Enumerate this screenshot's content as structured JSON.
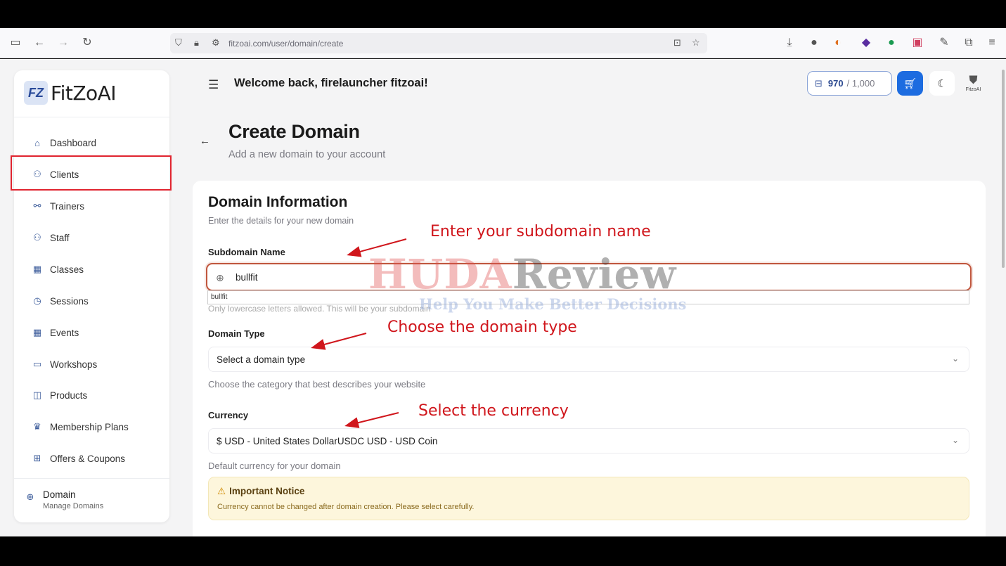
{
  "browser": {
    "url": "fitzoai.com/user/domain/create"
  },
  "brand": {
    "logo_mark": "FZ",
    "name": "FitZoAI"
  },
  "sidebar": {
    "items": [
      {
        "label": "Dashboard",
        "icon": "home-icon"
      },
      {
        "label": "Clients",
        "icon": "users-icon"
      },
      {
        "label": "Trainers",
        "icon": "trainers-icon"
      },
      {
        "label": "Staff",
        "icon": "staff-icon"
      },
      {
        "label": "Classes",
        "icon": "calendar-icon"
      },
      {
        "label": "Sessions",
        "icon": "timer-icon"
      },
      {
        "label": "Events",
        "icon": "calendar-icon"
      },
      {
        "label": "Workshops",
        "icon": "monitor-icon"
      },
      {
        "label": "Products",
        "icon": "bag-icon"
      },
      {
        "label": "Membership Plans",
        "icon": "crown-icon"
      },
      {
        "label": "Offers & Coupons",
        "icon": "gift-icon"
      }
    ],
    "footer": {
      "title": "Domain",
      "subtitle": "Manage Domains"
    }
  },
  "header": {
    "welcome": "Welcome back, firelauncher fitzoai!",
    "credits_value": "970",
    "credits_max": "/ 1,000",
    "avatar_text": "FitzoAI"
  },
  "page": {
    "title": "Create Domain",
    "subtitle": "Add a new domain to your account"
  },
  "form": {
    "section_title": "Domain Information",
    "section_subtitle": "Enter the details for your new domain",
    "subdomain_label": "Subdomain Name",
    "subdomain_value": "bullfit",
    "autocomplete_suggestion": "bullfit",
    "subdomain_hint": "Only lowercase letters allowed. This will be your subdomain",
    "domain_type_label": "Domain Type",
    "domain_type_value": "Select a domain type",
    "domain_type_help": "Choose the category that best describes your website",
    "currency_label": "Currency",
    "currency_value": "$ USD - United States DollarUSDC USD - USD Coin",
    "currency_help": "Default currency for your domain",
    "notice_title": "Important Notice",
    "notice_body": "Currency cannot be changed after domain creation. Please select carefully."
  },
  "annotations": {
    "subdomain": "Enter your subdomain name",
    "domain_type": "Choose the domain type",
    "currency": "Select the currency",
    "arrow_color": "#d0161c"
  },
  "watermark": {
    "part1": "HUDA",
    "part2": "Review",
    "tagline": "Help You Make Better Decisions"
  }
}
